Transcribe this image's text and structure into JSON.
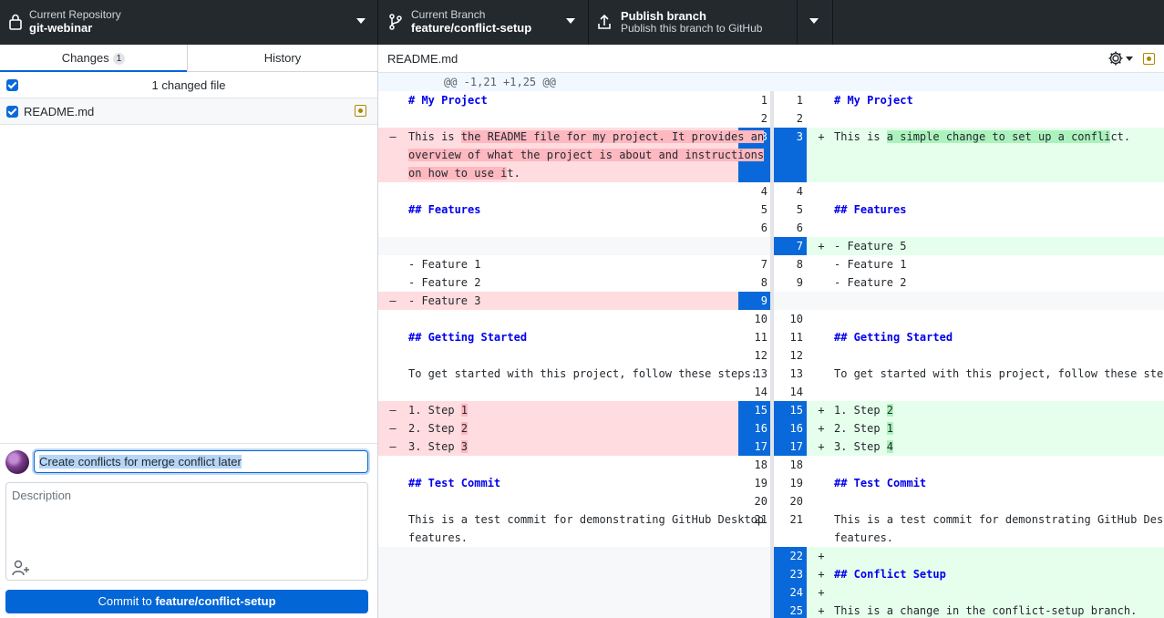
{
  "toolbar": {
    "repository": {
      "title": "Current Repository",
      "value": "git-webinar"
    },
    "branch": {
      "title": "Current Branch",
      "value": "feature/conflict-setup"
    },
    "publish": {
      "title": "Publish branch",
      "subtitle": "Publish this branch to GitHub"
    }
  },
  "sidebar": {
    "tabs": [
      {
        "label": "Changes",
        "badge": "1"
      },
      {
        "label": "History"
      }
    ],
    "changed_files_label": "1 changed file",
    "files": [
      {
        "name": "README.md",
        "status": "modified"
      }
    ]
  },
  "commit": {
    "summary": "Create conflicts for merge conflict later",
    "description_placeholder": "Description",
    "button_prefix": "Commit to ",
    "button_branch": "feature/conflict-setup"
  },
  "diff": {
    "file": "README.md",
    "hunk_header": "@@ -1,21 +1,25 @@",
    "rows": [
      {
        "ln": "1",
        "rn": "1",
        "left": [
          [
            "# My Project",
            "h"
          ]
        ],
        "right": [
          [
            "# My Project",
            "h"
          ]
        ],
        "type": "ctx"
      },
      {
        "ln": "2",
        "rn": "2",
        "left": [],
        "right": [],
        "type": "ctx"
      },
      {
        "ln": "3",
        "rn": "3",
        "type": "chg",
        "h": 3,
        "left": [
          [
            "This is ",
            ""
          ],
          [
            "the README file for my project. It provides an",
            "d"
          ]
        ],
        "left2": [
          [
            "overview of what the project is about and instructions",
            "d"
          ]
        ],
        "left3": [
          [
            "on how to use i",
            "d"
          ],
          [
            "t.",
            ""
          ]
        ],
        "right": [
          [
            "This is ",
            ""
          ],
          [
            "a simple change to set up a confli",
            "a"
          ],
          [
            "ct.",
            ""
          ]
        ]
      },
      {
        "ln": "4",
        "rn": "4",
        "left": [],
        "right": [],
        "type": "ctx"
      },
      {
        "ln": "5",
        "rn": "5",
        "left": [
          [
            "## Features",
            "h"
          ]
        ],
        "right": [
          [
            "## Features",
            "h"
          ]
        ],
        "type": "ctx"
      },
      {
        "ln": "6",
        "rn": "6",
        "left": [],
        "right": [],
        "type": "ctx"
      },
      {
        "ln": "",
        "rn": "7",
        "left": [],
        "right": [
          [
            "- Feature 5",
            ""
          ]
        ],
        "type": "add"
      },
      {
        "ln": "7",
        "rn": "8",
        "left": [
          [
            "- Feature 1",
            ""
          ]
        ],
        "right": [
          [
            "- Feature 1",
            ""
          ]
        ],
        "type": "ctx"
      },
      {
        "ln": "8",
        "rn": "9",
        "left": [
          [
            "- Feature 2",
            ""
          ]
        ],
        "right": [
          [
            "- Feature 2",
            ""
          ]
        ],
        "type": "ctx"
      },
      {
        "ln": "9",
        "rn": "",
        "left": [
          [
            "- Feature 3",
            ""
          ]
        ],
        "right": [],
        "type": "del"
      },
      {
        "ln": "10",
        "rn": "10",
        "left": [],
        "right": [],
        "type": "ctx"
      },
      {
        "ln": "11",
        "rn": "11",
        "left": [
          [
            "## Getting Started",
            "h"
          ]
        ],
        "right": [
          [
            "## Getting Started",
            "h"
          ]
        ],
        "type": "ctx"
      },
      {
        "ln": "12",
        "rn": "12",
        "left": [],
        "right": [],
        "type": "ctx"
      },
      {
        "ln": "13",
        "rn": "13",
        "left": [
          [
            "To get started with this project, follow these steps:",
            ""
          ]
        ],
        "right": [
          [
            "To get started with this project, follow these steps:",
            ""
          ]
        ],
        "type": "ctx"
      },
      {
        "ln": "14",
        "rn": "14",
        "left": [],
        "right": [],
        "type": "ctx"
      },
      {
        "ln": "15",
        "rn": "15",
        "left": [
          [
            "1. Step ",
            ""
          ],
          [
            "1",
            "d"
          ]
        ],
        "right": [
          [
            "1. Step ",
            ""
          ],
          [
            "2",
            "a"
          ]
        ],
        "type": "chg1"
      },
      {
        "ln": "16",
        "rn": "16",
        "left": [
          [
            "2. Step ",
            ""
          ],
          [
            "2",
            "d"
          ]
        ],
        "right": [
          [
            "2. Step ",
            ""
          ],
          [
            "1",
            "a"
          ]
        ],
        "type": "chg1"
      },
      {
        "ln": "17",
        "rn": "17",
        "left": [
          [
            "3. Step ",
            ""
          ],
          [
            "3",
            "d"
          ]
        ],
        "right": [
          [
            "3. Step ",
            ""
          ],
          [
            "4",
            "a"
          ]
        ],
        "type": "chg1"
      },
      {
        "ln": "18",
        "rn": "18",
        "left": [],
        "right": [],
        "type": "ctx"
      },
      {
        "ln": "19",
        "rn": "19",
        "left": [
          [
            "## Test Commit",
            "h"
          ]
        ],
        "right": [
          [
            "## Test Commit",
            "h"
          ]
        ],
        "type": "ctx"
      },
      {
        "ln": "20",
        "rn": "20",
        "left": [],
        "right": [],
        "type": "ctx"
      },
      {
        "ln": "21",
        "rn": "21",
        "type": "ctx2",
        "left": [
          [
            "This is a test commit for demonstrating GitHub Desktop",
            ""
          ]
        ],
        "left2": [
          [
            "features.",
            ""
          ]
        ],
        "right": [
          [
            "This is a test commit for demonstrating GitHub Desktop",
            ""
          ]
        ],
        "right2": [
          [
            "features.",
            ""
          ]
        ]
      },
      {
        "ln": "",
        "rn": "22",
        "left": [],
        "right": [],
        "type": "add"
      },
      {
        "ln": "",
        "rn": "23",
        "left": [],
        "right": [
          [
            "## Conflict Setup",
            "h"
          ]
        ],
        "type": "add"
      },
      {
        "ln": "",
        "rn": "24",
        "left": [],
        "right": [],
        "type": "add"
      },
      {
        "ln": "",
        "rn": "25",
        "left": [],
        "right": [
          [
            "This is a change in the conflict-setup branch.",
            ""
          ]
        ],
        "type": "add"
      }
    ]
  },
  "colors": {
    "accent": "#0366d6",
    "deleted_bg": "#ffdce0",
    "added_bg": "#e6ffec",
    "selected_gutter": "#0969da"
  },
  "icons": {
    "repository": "lock-icon",
    "branch": "git-branch-icon",
    "publish": "upload-icon",
    "settings": "gear-icon",
    "coauthor": "person-add-icon",
    "file_status": "modified-file-icon"
  }
}
